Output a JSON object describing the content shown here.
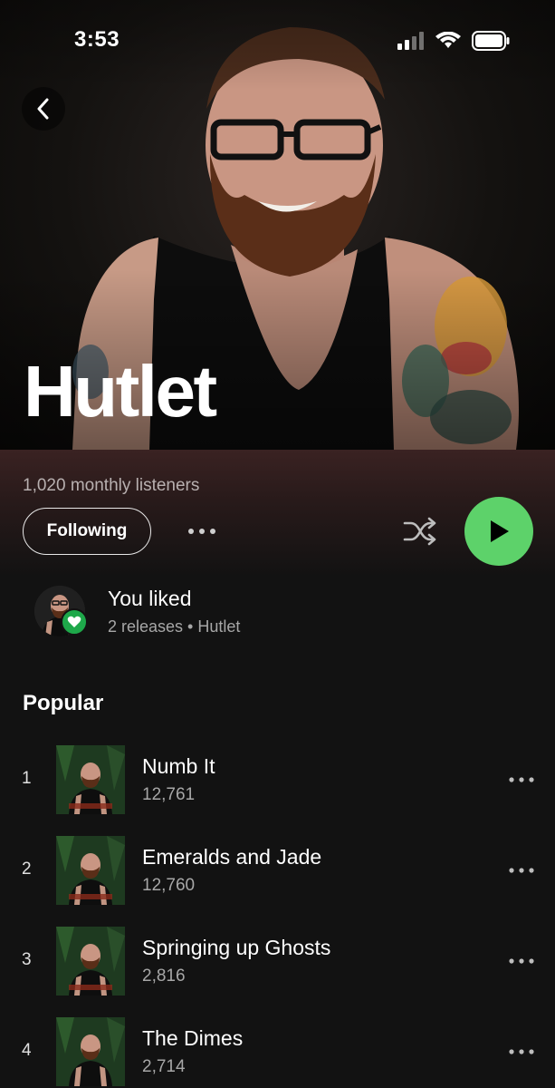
{
  "status_bar": {
    "time": "3:53",
    "signal_icon": "cellular-signal-icon",
    "wifi_icon": "wifi-icon",
    "battery_icon": "battery-icon"
  },
  "artist": {
    "name": "Hutlet",
    "monthly_listeners": "1,020 monthly listeners"
  },
  "actions": {
    "follow_label": "Following",
    "more_icon": "more-horizontal-icon",
    "shuffle_icon": "shuffle-icon",
    "play_icon": "play-icon",
    "accent_color": "#1ed760"
  },
  "liked": {
    "title": "You liked",
    "subtitle": "2 releases • Hutlet",
    "badge_icon": "heart-icon"
  },
  "popular": {
    "title": "Popular",
    "tracks": [
      {
        "rank": "1",
        "title": "Numb It",
        "plays": "12,761"
      },
      {
        "rank": "2",
        "title": "Emeralds and Jade",
        "plays": "12,760"
      },
      {
        "rank": "3",
        "title": "Springing up Ghosts",
        "plays": "2,816"
      },
      {
        "rank": "4",
        "title": "The Dimes",
        "plays": "2,714"
      }
    ]
  }
}
